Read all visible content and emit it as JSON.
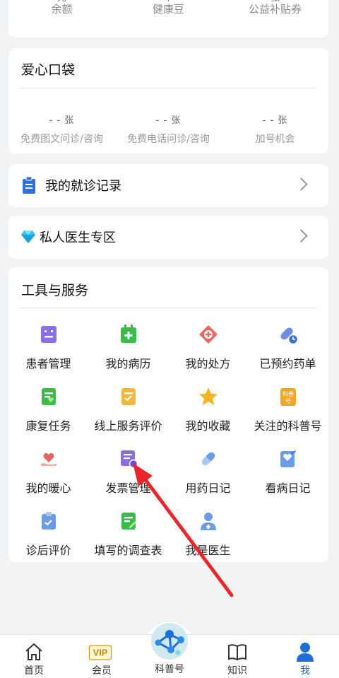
{
  "balance": {
    "items": [
      {
        "value": "元",
        "label": "余额"
      },
      {
        "value": "个",
        "label": "健康豆"
      },
      {
        "value": "张",
        "label": "公益补贴券"
      }
    ]
  },
  "pocket": {
    "title": "爱心口袋",
    "items": [
      {
        "value": "- - 张",
        "label": "免费图文问诊/咨询"
      },
      {
        "value": "- - 张",
        "label": "免费电话问诊/咨询"
      },
      {
        "value": "- - 张",
        "label": "加号机会"
      }
    ]
  },
  "records": {
    "label": "我的就诊记录"
  },
  "doctor_zone": {
    "label": "私人医生专区"
  },
  "tools": {
    "title": "工具与服务",
    "items": [
      {
        "label": "患者管理",
        "icon": "patient-management-icon"
      },
      {
        "label": "我的病历",
        "icon": "medical-record-icon"
      },
      {
        "label": "我的处方",
        "icon": "prescription-icon"
      },
      {
        "label": "已预约药单",
        "icon": "booked-medicine-icon"
      },
      {
        "label": "康复任务",
        "icon": "rehab-task-icon"
      },
      {
        "label": "线上服务评价",
        "icon": "service-review-icon"
      },
      {
        "label": "我的收藏",
        "icon": "star-icon"
      },
      {
        "label": "关注的科普号",
        "icon": "followed-science-icon"
      },
      {
        "label": "我的暖心",
        "icon": "heart-hand-icon"
      },
      {
        "label": "发票管理",
        "icon": "invoice-icon"
      },
      {
        "label": "用药日记",
        "icon": "pill-icon"
      },
      {
        "label": "看病日记",
        "icon": "visit-diary-icon"
      },
      {
        "label": "诊后评价",
        "icon": "post-visit-review-icon"
      },
      {
        "label": "填写的调查表",
        "icon": "survey-icon"
      },
      {
        "label": "我是医生",
        "icon": "doctor-icon"
      }
    ]
  },
  "tabbar": {
    "tabs": [
      {
        "label": "首页"
      },
      {
        "label": "会员"
      },
      {
        "label": "科普号"
      },
      {
        "label": "知识"
      },
      {
        "label": "我"
      }
    ],
    "vip_text": "VIP",
    "science_mini_text": "科普号"
  },
  "colors": {
    "accent": "#1e6fd9",
    "arrow": "#e8262b"
  }
}
